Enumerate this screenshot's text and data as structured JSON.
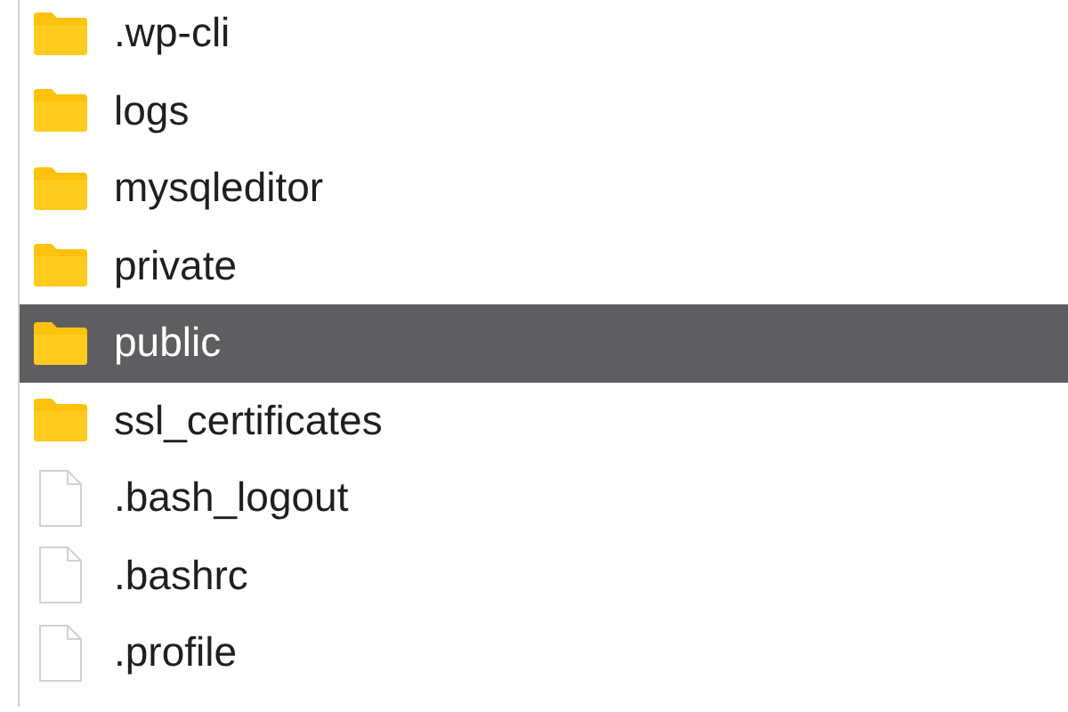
{
  "files": [
    {
      "name": ".wp-cli",
      "kind": "folder",
      "selected": false
    },
    {
      "name": "logs",
      "kind": "folder",
      "selected": false
    },
    {
      "name": "mysqleditor",
      "kind": "folder",
      "selected": false
    },
    {
      "name": "private",
      "kind": "folder",
      "selected": false
    },
    {
      "name": "public",
      "kind": "folder",
      "selected": true
    },
    {
      "name": "ssl_certificates",
      "kind": "folder",
      "selected": false
    },
    {
      "name": ".bash_logout",
      "kind": "file",
      "selected": false
    },
    {
      "name": ".bashrc",
      "kind": "file",
      "selected": false
    },
    {
      "name": ".profile",
      "kind": "file",
      "selected": false
    }
  ]
}
